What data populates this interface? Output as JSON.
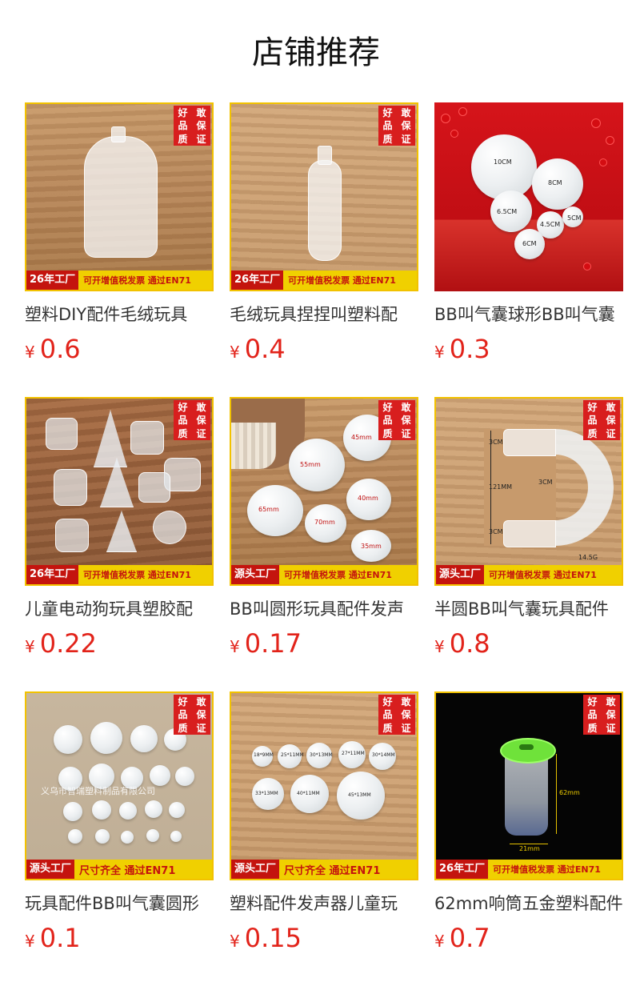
{
  "page": {
    "title": "店铺推荐"
  },
  "currency": "¥",
  "badge_chars": [
    "好",
    "敢",
    "品",
    "保",
    "质",
    "证"
  ],
  "colors": {
    "price": "#e2231a",
    "badge": "#d81e1e",
    "strip": "#f0d000"
  },
  "products": [
    {
      "name": "塑料DIY配件毛绒玩具",
      "price": "0.6",
      "strip_tag": "26年工厂",
      "strip_text": "可开增值税发票  通过EN71"
    },
    {
      "name": "毛绒玩具捏捏叫塑料配",
      "price": "0.4",
      "strip_tag": "26年工厂",
      "strip_text": "可开增值税发票  通过EN71"
    },
    {
      "name": "BB叫气囊球形BB叫气囊",
      "price": "0.3"
    },
    {
      "name": "儿童电动狗玩具塑胶配",
      "price": "0.22",
      "strip_tag": "26年工厂",
      "strip_text": "可开增值税发票  通过EN71"
    },
    {
      "name": "BB叫圆形玩具配件发声",
      "price": "0.17",
      "strip_tag": "源头工厂",
      "strip_text": "可开增值税发票  通过EN71"
    },
    {
      "name": "半圆BB叫气囊玩具配件",
      "price": "0.8",
      "strip_tag": "源头工厂",
      "strip_text": "可开增值税发票  通过EN71"
    },
    {
      "name": "玩具配件BB叫气囊圆形",
      "price": "0.1",
      "strip_tag": "源头工厂",
      "strip_text": "尺寸齐全  通过EN71"
    },
    {
      "name": "塑料配件发声器儿童玩",
      "price": "0.15",
      "strip_tag": "源头工厂",
      "strip_text": "尺寸齐全  通过EN71"
    },
    {
      "name": "62mm响筒五金塑料配件",
      "price": "0.7",
      "strip_tag": "26年工厂",
      "strip_text": "可开增值税发票  通过EN71"
    }
  ],
  "image_labels": {
    "p3": [
      "10CM",
      "8CM",
      "6.5CM",
      "4.5CM",
      "5CM",
      "6CM"
    ],
    "p5": [
      "45mm",
      "55mm",
      "65mm",
      "40mm",
      "70mm",
      "35mm"
    ],
    "p6": [
      "3CM",
      "121MM",
      "3CM",
      "3CM",
      "14.5G"
    ],
    "p8": [
      "18*9MM",
      "25*11MM",
      "30*13MM",
      "27*11MM",
      "30*14MM",
      "33*13MM",
      "40*11MM",
      "45*13MM"
    ],
    "p9": [
      "62mm",
      "21mm"
    ]
  },
  "watermark": "义乌市智瑞塑料制品有限公司"
}
